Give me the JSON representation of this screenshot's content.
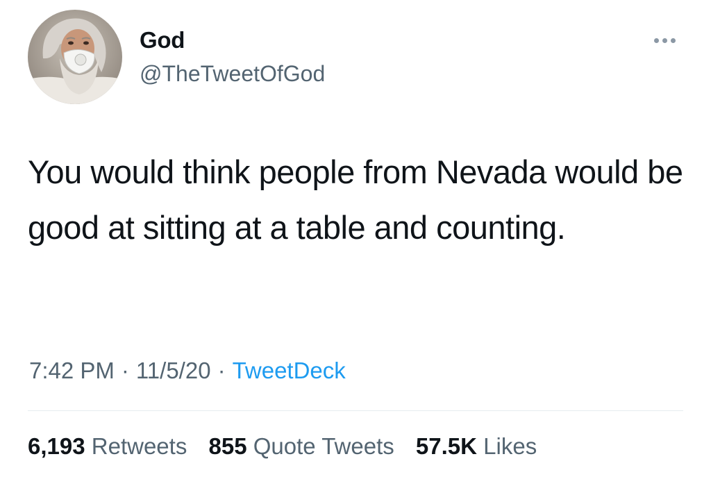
{
  "user": {
    "display_name": "God",
    "handle": "@TheTweetOfGod"
  },
  "avatar": {
    "icon": "profile-photo-bearded-man-with-face-mask"
  },
  "more_menu": {
    "icon": "more-horizontal-icon"
  },
  "tweet": {
    "text": "You would think people from Nevada would be good at sitting at a table and counting."
  },
  "meta": {
    "time": "7:42 PM",
    "date": "11/5/20",
    "separator": "·",
    "source": "TweetDeck"
  },
  "stats": {
    "retweets_count": "6,193",
    "retweets_label": "Retweets",
    "quotes_count": "855",
    "quotes_label": "Quote Tweets",
    "likes_count": "57.5K",
    "likes_label": "Likes"
  },
  "colors": {
    "text_primary": "#0f1419",
    "text_secondary": "#536471",
    "link": "#1d9bf0",
    "divider": "#e6ecf0"
  }
}
